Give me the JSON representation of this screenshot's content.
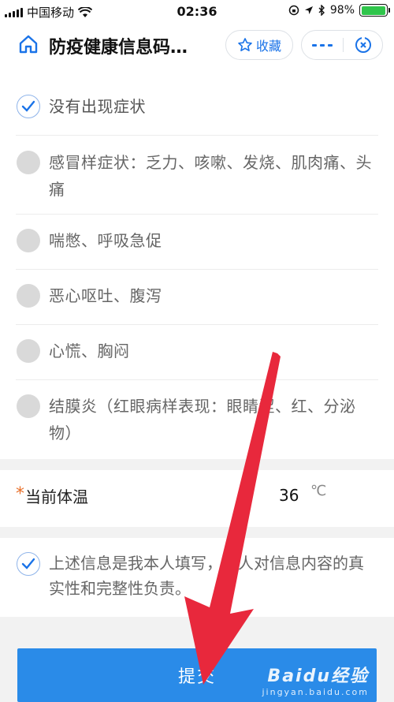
{
  "status_bar": {
    "carrier": "中国移动",
    "time": "02:36",
    "battery": "98%",
    "battery_level": 0.98
  },
  "nav": {
    "title": "防疫健康信息码…",
    "favorite_label": "收藏"
  },
  "options": [
    {
      "label": "没有出现症状",
      "checked": true
    },
    {
      "label": "感冒样症状：乏力、咳嗽、发烧、肌肉痛、头痛",
      "checked": false
    },
    {
      "label": "喘憋、呼吸急促",
      "checked": false
    },
    {
      "label": "恶心呕吐、腹泻",
      "checked": false
    },
    {
      "label": "心慌、胸闷",
      "checked": false
    },
    {
      "label": "结膜炎（红眼病样表现：眼睛涩、红、分泌物）",
      "checked": false
    }
  ],
  "temperature": {
    "required_mark": "*",
    "label": "当前体温",
    "value": "36",
    "unit": "℃"
  },
  "declaration": {
    "text": "上述信息是我本人填写，本人对信息内容的真实性和完整性负责。",
    "checked": true
  },
  "submit": {
    "label": "提交"
  },
  "watermark": {
    "logo": "Baidu经验",
    "sub": "jingyan.baidu.com"
  },
  "colors": {
    "accent": "#2a8be8",
    "brand_blue": "#1a73e8",
    "required": "#e8702a",
    "arrow": "#e8283c"
  }
}
